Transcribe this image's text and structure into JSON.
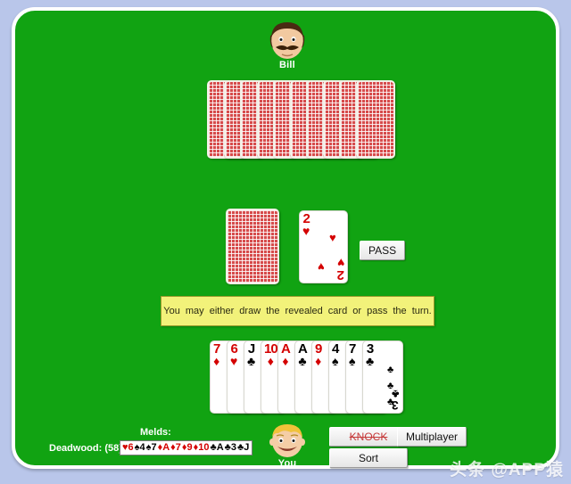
{
  "table": {
    "felt_color": "#11a312",
    "page_bg": "#b9c6ea"
  },
  "opponent": {
    "name": "Bill",
    "avatar": "man-face-mustache-avatar",
    "hand_card_count": 10,
    "hand_face_down": true
  },
  "player": {
    "name": "You",
    "avatar": "blond-boy-face-avatar",
    "hand": [
      {
        "rank": "7",
        "suit": "♦",
        "color": "red"
      },
      {
        "rank": "6",
        "suit": "♥",
        "color": "red"
      },
      {
        "rank": "J",
        "suit": "♣",
        "color": "black"
      },
      {
        "rank": "10",
        "suit": "♦",
        "color": "red"
      },
      {
        "rank": "A",
        "suit": "♦",
        "color": "red"
      },
      {
        "rank": "A",
        "suit": "♣",
        "color": "black"
      },
      {
        "rank": "9",
        "suit": "♦",
        "color": "red"
      },
      {
        "rank": "4",
        "suit": "♠",
        "color": "black"
      },
      {
        "rank": "7",
        "suit": "♠",
        "color": "black"
      },
      {
        "rank": "3",
        "suit": "♣",
        "color": "black"
      }
    ]
  },
  "stock": {
    "label": "stock-pile",
    "face_down": true
  },
  "discard": {
    "rank": "2",
    "suit": "♥",
    "color": "red"
  },
  "message": {
    "text": "You may either draw the revealed card or pass the turn.",
    "bg": "#f2f27a"
  },
  "buttons": {
    "pass": "PASS",
    "knock": "KNOCK",
    "knock_disabled": true,
    "multiplayer": "Multiplayer",
    "sort": "Sort"
  },
  "score": {
    "melds_label": "Melds:",
    "deadwood_label": "Deadwood: (58)",
    "deadwood_cards": [
      {
        "suit": "♥",
        "rank": "6",
        "color": "red"
      },
      {
        "suit": "♠",
        "rank": "4",
        "color": "black"
      },
      {
        "suit": "♠",
        "rank": "7",
        "color": "black"
      },
      {
        "suit": "♦",
        "rank": "A",
        "color": "red"
      },
      {
        "suit": "♦",
        "rank": "7",
        "color": "red"
      },
      {
        "suit": "♦",
        "rank": "9",
        "color": "red"
      },
      {
        "suit": "♦",
        "rank": "10",
        "color": "red"
      },
      {
        "suit": "♣",
        "rank": "A",
        "color": "black"
      },
      {
        "suit": "♣",
        "rank": "3",
        "color": "black"
      },
      {
        "suit": "♣",
        "rank": "J",
        "color": "black"
      }
    ]
  },
  "watermark": {
    "text": "头条 @APP猿"
  }
}
